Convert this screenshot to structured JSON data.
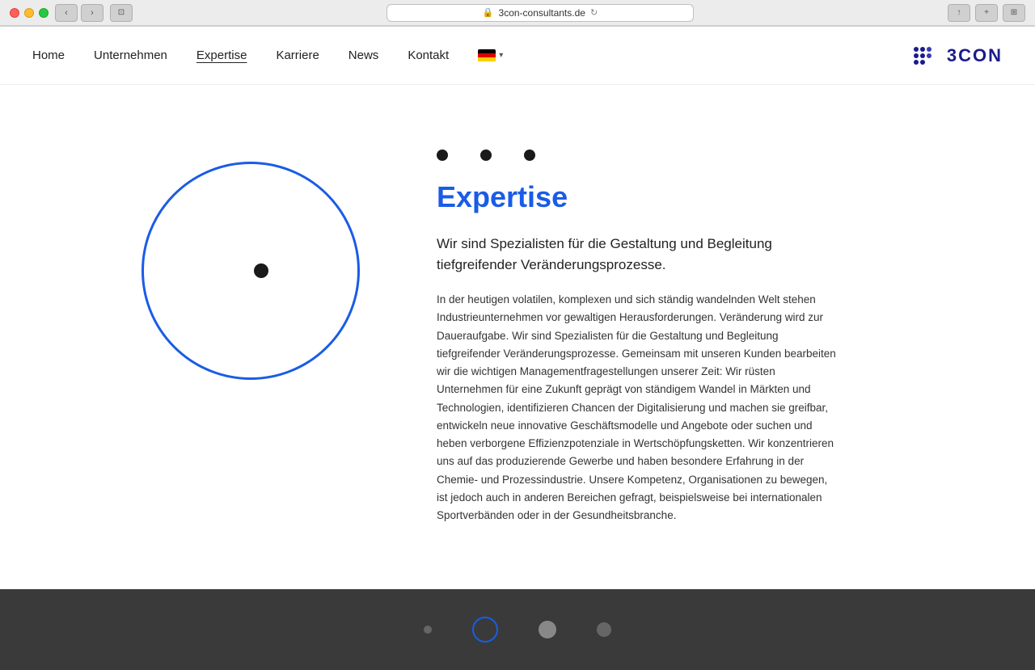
{
  "browser": {
    "url": "3con-consultants.de",
    "reload_icon": "↻"
  },
  "nav": {
    "home": "Home",
    "unternehmen": "Unternehmen",
    "expertise": "Expertise",
    "karriere": "Karriere",
    "news": "News",
    "kontakt": "Kontakt",
    "lang": "DE",
    "chevron": "▾"
  },
  "logo": {
    "text": "3CON"
  },
  "main": {
    "title": "Expertise",
    "subtitle": "Wir sind Spezialisten für die Gestaltung und Begleitung tiefgreifender Veränderungsprozesse.",
    "body": "In der heutigen volatilen, komplexen und sich ständig wandelnden Welt stehen Industrieunternehmen vor gewaltigen Herausforderungen. Veränderung wird zur Daueraufgabe. Wir sind Spezialisten für die Gestaltung und Begleitung tiefgreifender Veränderungsprozesse. Gemeinsam mit unseren Kunden bearbeiten wir die wichtigen Managementfragestellungen unserer Zeit:  Wir rüsten Unternehmen für eine Zukunft geprägt von ständigem Wandel in Märkten und Technologien, identifizieren Chancen der Digitalisierung und machen sie greifbar, entwickeln neue innovative Geschäftsmodelle und Angebote oder suchen und heben verborgene Effizienzpotenziale in Wertschöpfungsketten. Wir konzentrieren uns auf das produzierende Gewerbe und haben besondere Erfahrung in der Chemie- und Prozessindustrie. Unsere Kompetenz, Organisationen zu bewegen, ist jedoch auch in anderen Bereichen gefragt, beispielsweise bei internationalen Sportverbänden oder in der Gesundheitsbranche."
  }
}
